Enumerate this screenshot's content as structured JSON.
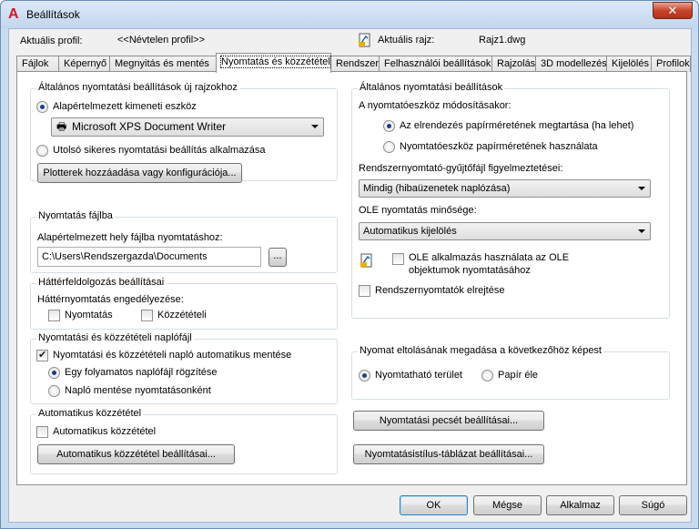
{
  "window": {
    "title": "Beállítások",
    "close_glyph": "✕"
  },
  "profile": {
    "label": "Aktuális profil:",
    "value": "<<Névtelen profil>>",
    "drawing_label": "Aktuális rajz:",
    "drawing_value": "Rajz1.dwg"
  },
  "tabs": [
    "Fájlok",
    "Képernyő",
    "Megnyitás és mentés",
    "Nyomtatás és közzététel",
    "Rendszer",
    "Felhasználói beállítások",
    "Rajzolás",
    "3D modellezés",
    "Kijelölés",
    "Profilok"
  ],
  "left": {
    "general": {
      "title": "Általános nyomtatási beállítások új rajzokhoz",
      "default_device_label": "Alapértelmezett kimeneti eszköz",
      "device_value": "Microsoft XPS Document Writer",
      "last_success_label": "Utolsó sikeres nyomtatási beállítás alkalmazása",
      "plotter_button": "Plotterek hozzáadása vagy konfigurációja..."
    },
    "print_file": {
      "title": "Nyomtatás fájlba",
      "label": "Alapértelmezett hely fájlba nyomtatáshoz:",
      "path": "C:\\Users\\Rendszergazda\\Documents",
      "browse": "..."
    },
    "background": {
      "title": "Háttérfeldolgozás beállításai",
      "label": "Háttérnyomtatás engedélyezése:",
      "opt_print": "Nyomtatás",
      "opt_publish": "Közzétételi"
    },
    "logfile": {
      "title": "Nyomtatási és közzétételi naplófájl",
      "auto_save": "Nyomtatási és közzétételi napló automatikus mentése",
      "continuous": "Egy folyamatos naplófájl rögzítése",
      "per_print": "Napló mentése nyomtatásonként"
    },
    "autopublish": {
      "title": "Automatikus közzététel",
      "checkbox": "Automatikus közzététel",
      "button": "Automatikus közzététel beállításai..."
    }
  },
  "right": {
    "general": {
      "title": "Általános nyomtatási beállítások",
      "change_label": "A nyomtatóeszköz módosításakor:",
      "keep_layout": "Az elrendezés papírméretének megtartása (ha lehet)",
      "use_device": "Nyomtatóeszköz papírméretének használata",
      "spool_label": "Rendszernyomtató-gyűjtőfájl figyelmeztetései:",
      "spool_value": "Mindig (hibaüzenetek naplózása)",
      "ole_label": "OLE nyomtatás minősége:",
      "ole_value": "Automatikus kijelölés",
      "ole_app_line1": "OLE alkalmazás használata az OLE",
      "ole_app_line2": "objektumok nyomtatásához",
      "hide_system": "Rendszernyomtatók elrejtése"
    },
    "offset": {
      "title": "Nyomat eltolásának megadása a következőhöz képest",
      "printable": "Nyomtatható terület",
      "paper_edge": "Papír éle"
    },
    "stamp_button": "Nyomtatási pecsét beállításai...",
    "style_button": "Nyomtatásistílus-táblázat beállításai..."
  },
  "footer": {
    "ok": "OK",
    "cancel": "Mégse",
    "apply": "Alkalmaz",
    "help": "Súgó"
  }
}
